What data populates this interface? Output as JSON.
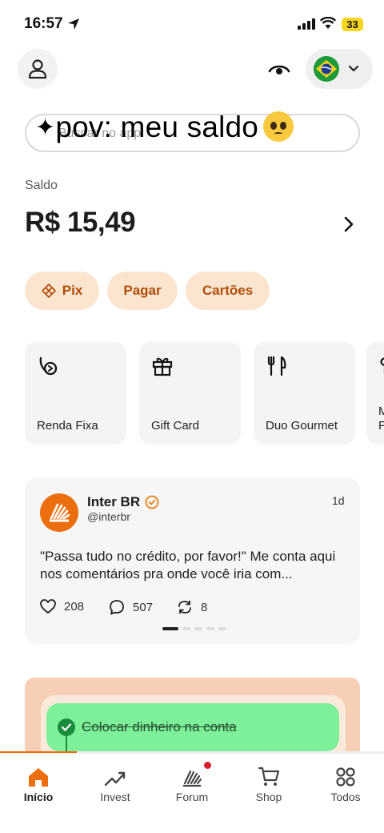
{
  "status_bar": {
    "time": "16:57",
    "battery": "33"
  },
  "search": {
    "placeholder": "Buscar no app"
  },
  "overlay_caption": "pov: meu saldo",
  "account": {
    "saldo_label": "Saldo",
    "balance": "R$ 15,49"
  },
  "quick_actions": [
    {
      "label": "Pix",
      "icon": "pix-icon"
    },
    {
      "label": "Pagar"
    },
    {
      "label": "Cartões"
    }
  ],
  "shortcuts": [
    {
      "label": "Renda Fixa",
      "icon": "renda-fixa-icon"
    },
    {
      "label": "Gift Card",
      "icon": "gift-icon"
    },
    {
      "label": "Duo Gourmet",
      "icon": "fork-knife-icon"
    },
    {
      "label_line1": "M",
      "label_line2": "P",
      "icon": "partial-icon"
    }
  ],
  "post": {
    "name": "Inter BR",
    "handle": "@interbr",
    "age": "1d",
    "text": "\"Passa tudo no crédito, por favor!\" Me conta aqui nos comentários pra onde você iria com...",
    "likes": "208",
    "comments": "507",
    "reposts": "8",
    "pages_total": 5,
    "page_active": 1
  },
  "promo": {
    "task": "Colocar dinheiro na conta",
    "progress_fraction": 0.2
  },
  "bottom_nav": [
    {
      "label": "Início",
      "icon": "home-icon",
      "active": true
    },
    {
      "label": "Invest",
      "icon": "trend-up-icon"
    },
    {
      "label": "Forum",
      "icon": "forum-icon",
      "badge": true
    },
    {
      "label": "Shop",
      "icon": "cart-icon"
    },
    {
      "label": "Todos",
      "icon": "grid-icon"
    }
  ],
  "colors": {
    "brand_orange": "#ec6f0f",
    "chip_bg": "#fbe5cf",
    "chip_text": "#b04c0a",
    "todo_green": "#7ef09a"
  }
}
